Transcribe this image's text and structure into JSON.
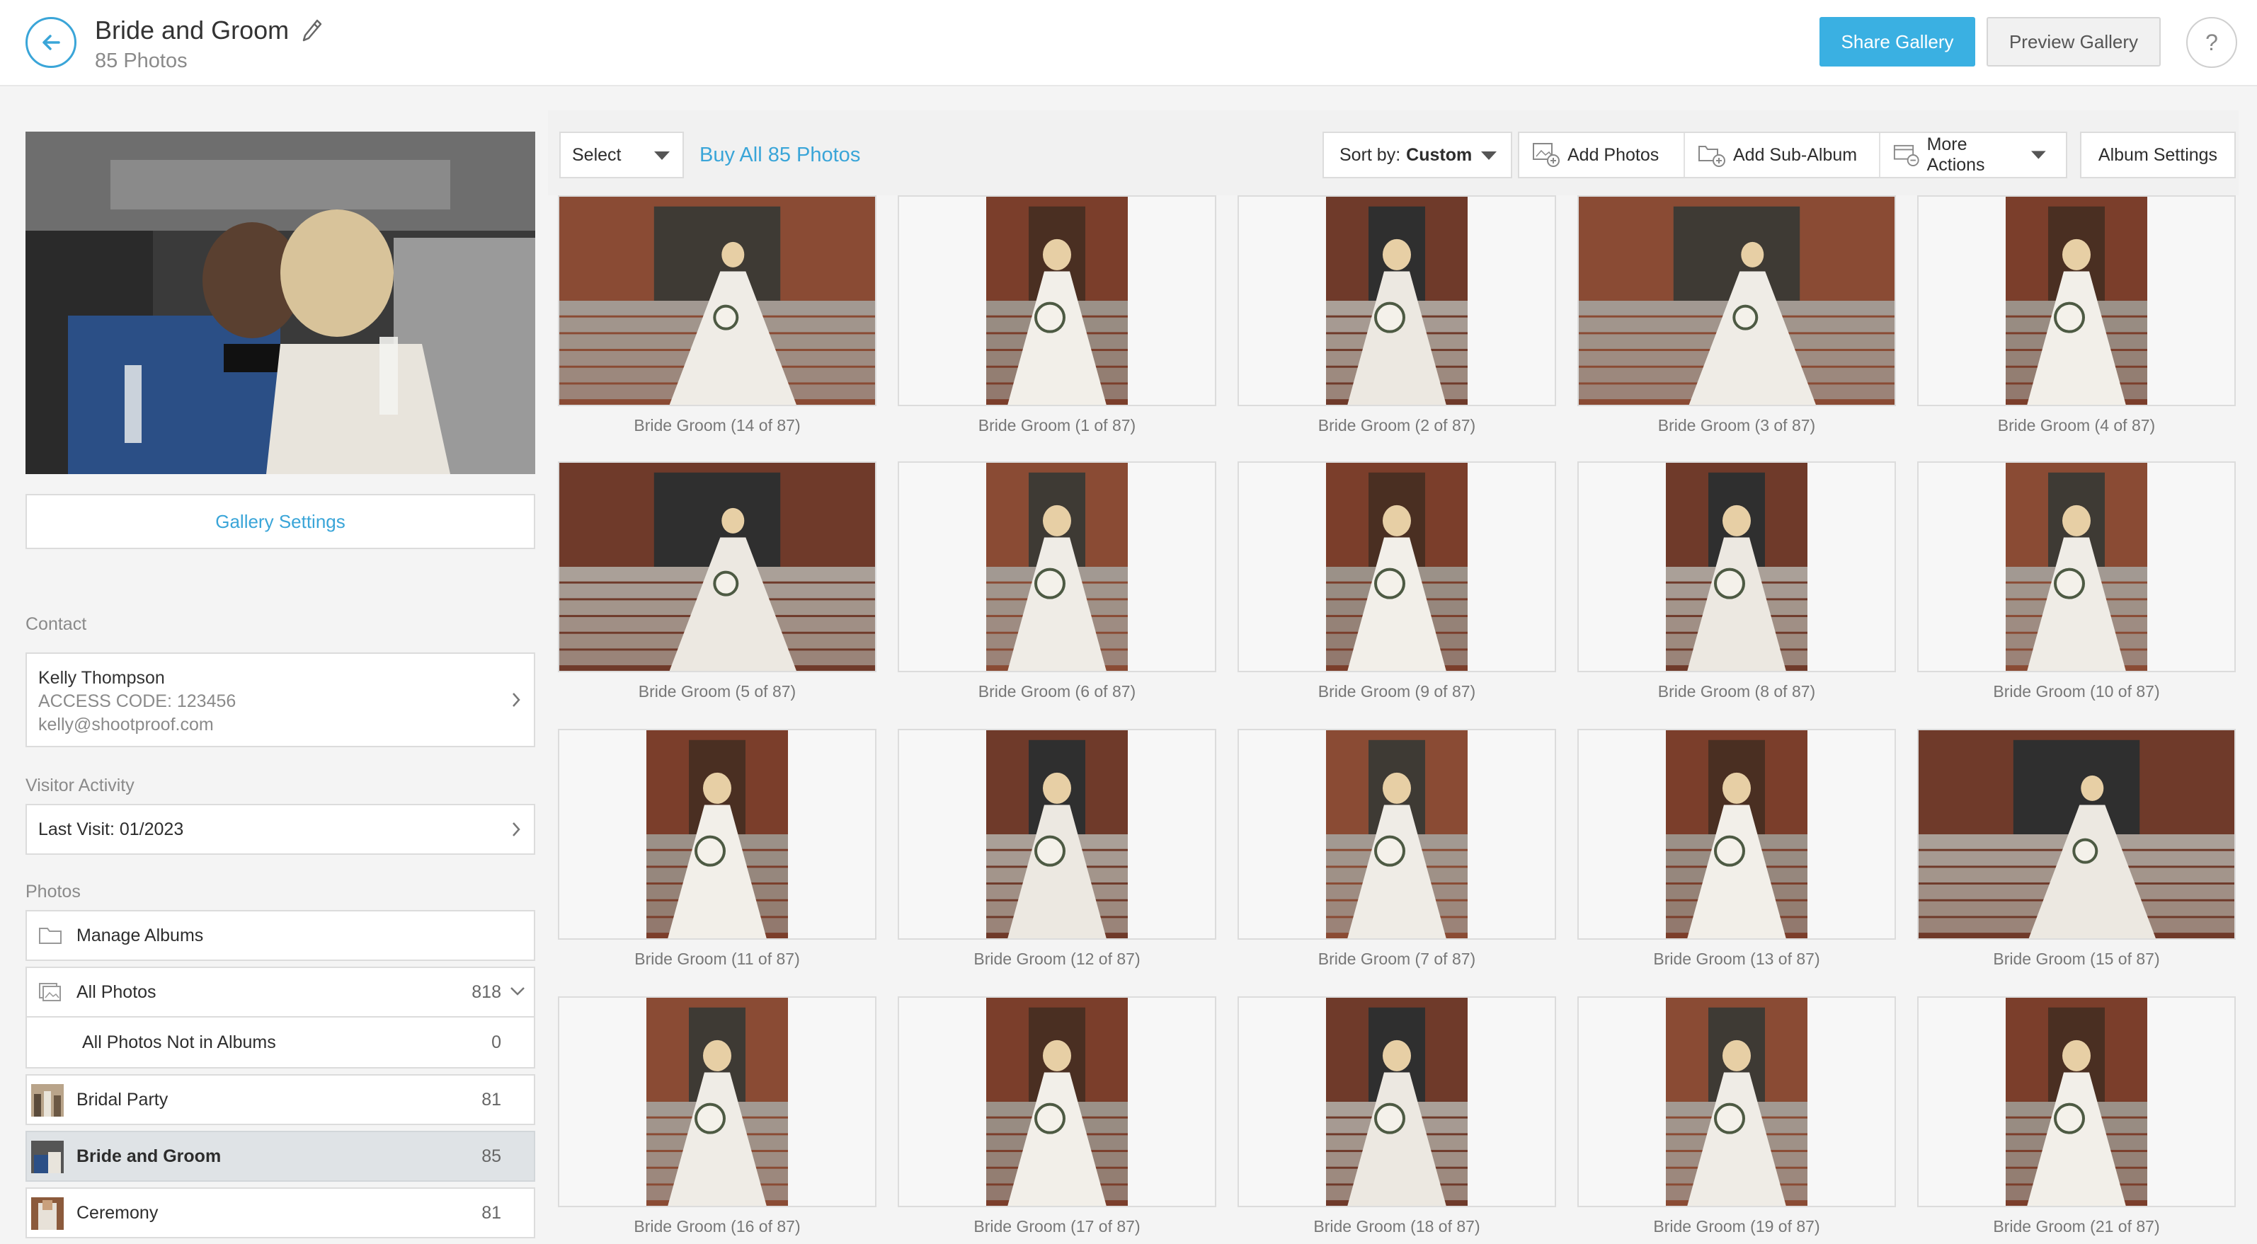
{
  "header": {
    "title": "Bride and Groom",
    "subtitle": "85 Photos",
    "share_label": "Share Gallery",
    "preview_label": "Preview Gallery",
    "help_label": "?"
  },
  "sidebar": {
    "gallery_settings_label": "Gallery Settings",
    "contact_label": "Contact",
    "contact": {
      "name": "Kelly Thompson",
      "access_code": "ACCESS CODE: 123456",
      "email": "kelly@shootproof.com"
    },
    "visitor_activity_label": "Visitor Activity",
    "last_visit": "Last Visit: 01/2023",
    "photos_label": "Photos",
    "manage_albums": "Manage Albums",
    "all_photos": {
      "label": "All Photos",
      "count": "818"
    },
    "not_in_albums": {
      "label": "All Photos Not in Albums",
      "count": "0"
    },
    "albums": [
      {
        "label": "Bridal Party",
        "count": "81"
      },
      {
        "label": "Bride and Groom",
        "count": "85"
      },
      {
        "label": "Ceremony",
        "count": "81"
      }
    ]
  },
  "toolbar": {
    "select_label": "Select",
    "buy_all_label": "Buy All 85 Photos",
    "sort_prefix": "Sort by:",
    "sort_value": "Custom",
    "add_photos": "Add Photos",
    "add_sub_album": "Add Sub-Album",
    "more_actions": "More Actions",
    "album_settings": "Album Settings"
  },
  "photos": [
    {
      "caption": "Bride Groom (14 of 87)",
      "orientation": "landscape"
    },
    {
      "caption": "Bride Groom (1 of 87)",
      "orientation": "portrait"
    },
    {
      "caption": "Bride Groom (2 of 87)",
      "orientation": "portrait"
    },
    {
      "caption": "Bride Groom (3 of 87)",
      "orientation": "landscape"
    },
    {
      "caption": "Bride Groom (4 of 87)",
      "orientation": "portrait"
    },
    {
      "caption": "Bride Groom (5 of 87)",
      "orientation": "landscape"
    },
    {
      "caption": "Bride Groom (6 of 87)",
      "orientation": "portrait"
    },
    {
      "caption": "Bride Groom (9 of 87)",
      "orientation": "portrait"
    },
    {
      "caption": "Bride Groom (8 of 87)",
      "orientation": "portrait"
    },
    {
      "caption": "Bride Groom (10 of 87)",
      "orientation": "portrait"
    },
    {
      "caption": "Bride Groom (11 of 87)",
      "orientation": "portrait"
    },
    {
      "caption": "Bride Groom (12 of 87)",
      "orientation": "portrait"
    },
    {
      "caption": "Bride Groom (7 of 87)",
      "orientation": "portrait"
    },
    {
      "caption": "Bride Groom (13 of 87)",
      "orientation": "portrait"
    },
    {
      "caption": "Bride Groom (15 of 87)",
      "orientation": "landscape"
    },
    {
      "caption": "Bride Groom (16 of 87)",
      "orientation": "portrait"
    },
    {
      "caption": "Bride Groom (17 of 87)",
      "orientation": "portrait"
    },
    {
      "caption": "Bride Groom (18 of 87)",
      "orientation": "portrait"
    },
    {
      "caption": "Bride Groom (19 of 87)",
      "orientation": "portrait"
    },
    {
      "caption": "Bride Groom (21 of 87)",
      "orientation": "portrait"
    }
  ],
  "colors": {
    "accent": "#3ab0e2",
    "link": "#3aa5d8",
    "active_row": "#dfe3e6"
  }
}
